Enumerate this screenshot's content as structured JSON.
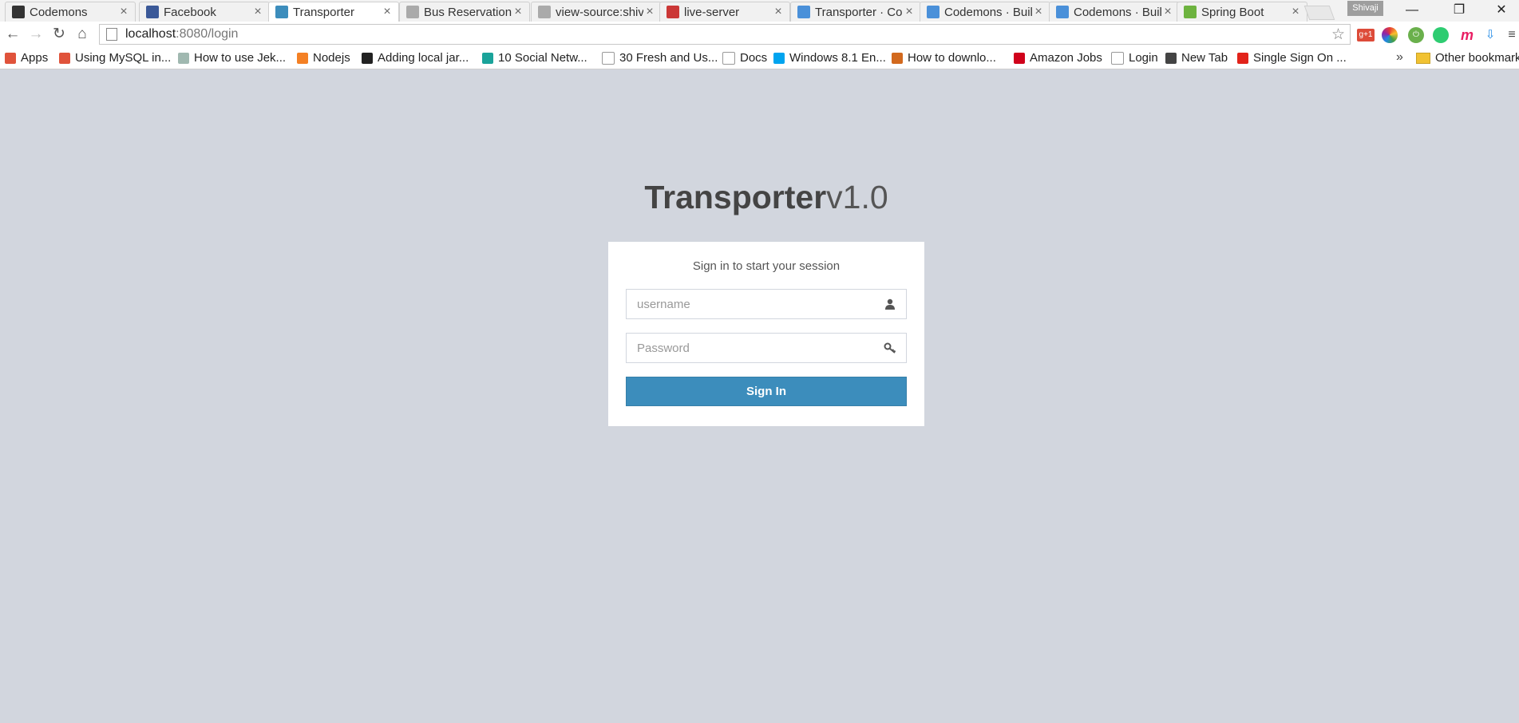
{
  "browser": {
    "tabs": [
      {
        "title": "Codemons",
        "icon": "github-icon",
        "color": "#333333"
      },
      {
        "title": "Facebook",
        "icon": "facebook-icon",
        "color": "#3b5998"
      },
      {
        "title": "Transporter",
        "icon": "feather-icon",
        "color": "#3c8dbc",
        "active": true
      },
      {
        "title": "Bus Reservation",
        "icon": "s-icon",
        "color": "#aaaaaa"
      },
      {
        "title": "view-source:shiv",
        "icon": "s-icon",
        "color": "#aaaaaa"
      },
      {
        "title": "live-server",
        "icon": "npm-icon",
        "color": "#cb3837"
      },
      {
        "title": "Transporter · Co",
        "icon": "loading-icon",
        "color": "#4a90d9"
      },
      {
        "title": "Codemons · Buil",
        "icon": "loading-icon",
        "color": "#4a90d9"
      },
      {
        "title": "Codemons · Buil",
        "icon": "loading-icon",
        "color": "#4a90d9"
      },
      {
        "title": "Spring Boot",
        "icon": "spring-icon",
        "color": "#6db33f"
      }
    ],
    "close_glyph": "×",
    "profile_name": "Shivaji",
    "url_host": "localhost",
    "url_path": ":8080/login",
    "bookmarks": [
      {
        "label": "Apps",
        "icon": "apps-grid-icon",
        "color": "#e0533b"
      },
      {
        "label": "Using MySQL in...",
        "icon": "mysql-icon",
        "color": "#e0533b"
      },
      {
        "label": "How to use Jek...",
        "icon": "jekyll-icon",
        "color": "#a0b8b0"
      },
      {
        "label": "Nodejs",
        "icon": "stack-icon",
        "color": "#f48024"
      },
      {
        "label": "Adding local jar...",
        "icon": "s-icon",
        "color": "#222222"
      },
      {
        "label": "10 Social Netw...",
        "icon": "square-icon",
        "color": "#1aa39a"
      },
      {
        "label": "30 Fresh and Us...",
        "icon": "page-icon",
        "color": "#ffffff"
      },
      {
        "label": "Docs",
        "icon": "page-icon",
        "color": "#ffffff"
      },
      {
        "label": "Windows 8.1 En...",
        "icon": "windows-icon",
        "color": "#00a4ef"
      },
      {
        "label": "How to downlo...",
        "icon": "e-icon",
        "color": "#d2691e"
      },
      {
        "label": "Amazon Jobs",
        "icon": "info-icon",
        "color": "#d0021b"
      },
      {
        "label": "Login",
        "icon": "blank-icon",
        "color": "#ffffff"
      },
      {
        "label": "New Tab",
        "icon": "newtab-icon",
        "color": "#444444"
      },
      {
        "label": "Single Sign On ...",
        "icon": "oracle-icon",
        "color": "#e2231a"
      }
    ],
    "bookmarks_more": "»",
    "other_bookmarks": "Other bookmarks"
  },
  "login": {
    "logo_bold": "Transporter",
    "logo_version": "v1.0",
    "message": "Sign in to start your session",
    "username_placeholder": "username",
    "password_placeholder": "Password",
    "signin_label": "Sign In"
  },
  "colors": {
    "page_bg": "#d2d6de",
    "button": "#3c8dbc"
  }
}
